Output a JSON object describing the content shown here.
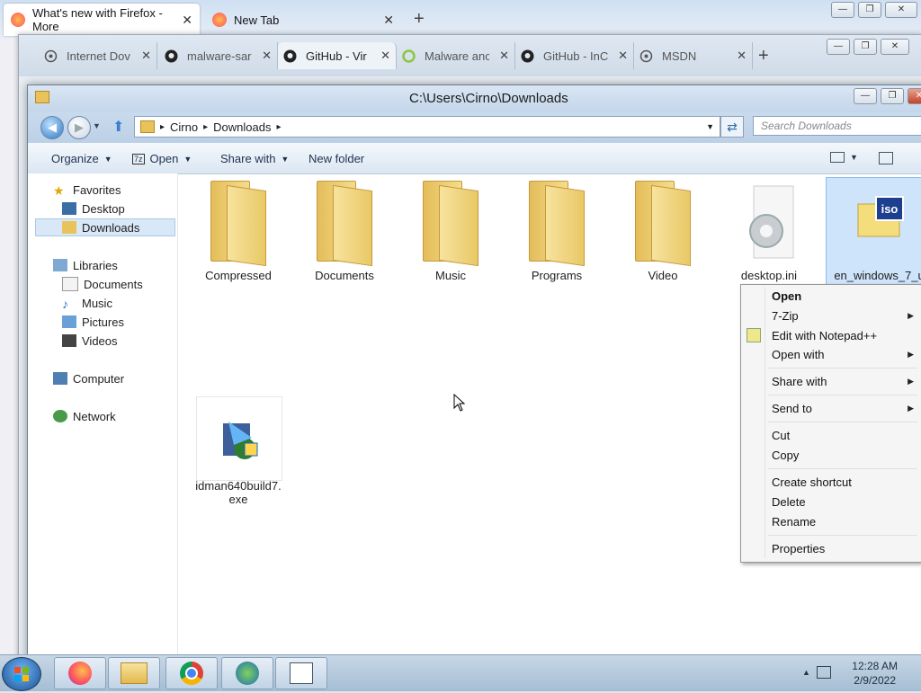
{
  "firefox": {
    "tabs": [
      {
        "label": "What's new with Firefox - More",
        "active": true
      },
      {
        "label": "New Tab",
        "active": false
      }
    ]
  },
  "browser2": {
    "tabs": [
      {
        "label": "Internet Dov",
        "icon": "globe-icon"
      },
      {
        "label": "malware-sar",
        "icon": "github-icon"
      },
      {
        "label": "GitHub - Vir",
        "icon": "github-icon",
        "active": true
      },
      {
        "label": "Malware anc",
        "icon": "leaf-icon"
      },
      {
        "label": "GitHub - InC",
        "icon": "github-icon"
      },
      {
        "label": "MSDN",
        "icon": "globe-icon"
      }
    ]
  },
  "explorer": {
    "title": "C:\\Users\\Cirno\\Downloads",
    "breadcrumb": [
      "Cirno",
      "Downloads"
    ],
    "search_placeholder": "Search Downloads",
    "commands": {
      "organize": "Organize",
      "open": "Open",
      "share_with": "Share with",
      "new_folder": "New folder"
    },
    "tree": {
      "favorites": "Favorites",
      "desktop": "Desktop",
      "downloads": "Downloads",
      "libraries": "Libraries",
      "documents": "Documents",
      "music": "Music",
      "pictures": "Pictures",
      "videos": "Videos",
      "computer": "Computer",
      "network": "Network"
    },
    "files": [
      {
        "name": "Compressed"
      },
      {
        "name": "Documents"
      },
      {
        "name": "Music"
      },
      {
        "name": "Programs"
      },
      {
        "name": "Video"
      },
      {
        "name": "desktop.ini"
      },
      {
        "name": "en_windows_7_ul"
      },
      {
        "name": "idman640build7.\nexe"
      }
    ]
  },
  "context_menu": {
    "open": "Open",
    "seven_zip": "7-Zip",
    "edit_notepad": "Edit with Notepad++",
    "open_with": "Open with",
    "share_with": "Share with",
    "send_to": "Send to",
    "cut": "Cut",
    "copy": "Copy",
    "create_shortcut": "Create shortcut",
    "delete": "Delete",
    "rename": "Rename",
    "properties": "Properties"
  },
  "clock": {
    "time": "12:28 AM",
    "date": "2/9/2022"
  },
  "colors": {
    "selection": "#cde4fb",
    "taskbar": "#b6cbe0",
    "folder": "#f0d57e"
  }
}
